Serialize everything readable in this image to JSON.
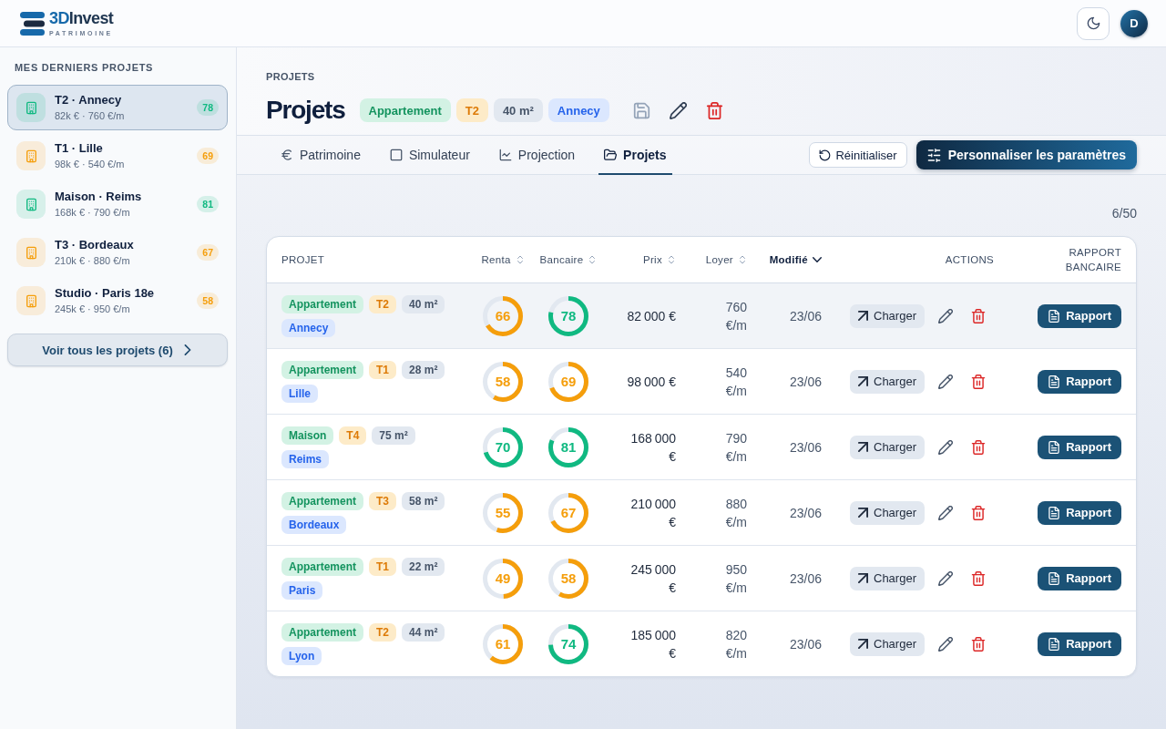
{
  "brand": {
    "name_lead": "3D",
    "name_rest": "Invest",
    "tagline": "PATRIMOINE"
  },
  "user": {
    "initial": "D"
  },
  "sidebar": {
    "title": "MES DERNIERS PROJETS",
    "items": [
      {
        "title": "T2 · Annecy",
        "subtitle": "82k € · 760 €/m",
        "score": "78",
        "color": "#10b981",
        "selected": true
      },
      {
        "title": "T1 · Lille",
        "subtitle": "98k € · 540 €/m",
        "score": "69",
        "color": "#f59e0b",
        "selected": false
      },
      {
        "title": "Maison · Reims",
        "subtitle": "168k € · 790 €/m",
        "score": "81",
        "color": "#10b981",
        "selected": false
      },
      {
        "title": "T3 · Bordeaux",
        "subtitle": "210k € · 880 €/m",
        "score": "67",
        "color": "#f59e0b",
        "selected": false
      },
      {
        "title": "Studio · Paris 18e",
        "subtitle": "245k € · 950 €/m",
        "score": "58",
        "color": "#f59e0b",
        "selected": false
      }
    ],
    "view_all": "Voir tous les projets (6)"
  },
  "page": {
    "breadcrumb": "PROJETS",
    "title": "Projets",
    "tags": [
      {
        "kind": "type",
        "label": "Appartement"
      },
      {
        "kind": "rooms",
        "label": "T2"
      },
      {
        "kind": "area",
        "label": "40 m²"
      },
      {
        "kind": "city",
        "label": "Annecy"
      }
    ],
    "actions": [
      {
        "kind": "save",
        "disabled": true
      },
      {
        "kind": "edit",
        "disabled": false
      },
      {
        "kind": "delete",
        "disabled": false
      }
    ]
  },
  "tabs": [
    {
      "kind": "euro",
      "label": "Patrimoine",
      "selected": false
    },
    {
      "kind": "square",
      "label": "Simulateur",
      "selected": false
    },
    {
      "kind": "chart",
      "label": "Projection",
      "selected": false
    },
    {
      "kind": "folder",
      "label": "Projets",
      "selected": true
    }
  ],
  "toolbar": {
    "reset": "Réinitialiser",
    "customize": "Personnaliser les paramètres"
  },
  "count": "6/50",
  "table": {
    "columns": [
      {
        "label": "PROJET",
        "sortable": false,
        "sorted": false
      },
      {
        "label": "Renta",
        "sortable": true,
        "sorted": false
      },
      {
        "label": "Bancaire",
        "sortable": true,
        "sorted": false
      },
      {
        "label": "Prix",
        "sortable": true,
        "sorted": false
      },
      {
        "label": "Loyer",
        "sortable": true,
        "sorted": false
      },
      {
        "label": "Modifié",
        "sortable": true,
        "sorted": true
      },
      {
        "label": "ACTIONS",
        "sortable": false,
        "sorted": false
      },
      {
        "label": "RAPPORT BANCAIRE",
        "sortable": false,
        "sorted": false
      }
    ],
    "rows": [
      {
        "selected": true,
        "tags": [
          {
            "kind": "type",
            "label": "Appartement"
          },
          {
            "kind": "rooms",
            "label": "T2"
          },
          {
            "kind": "area",
            "label": "40 m²"
          },
          {
            "kind": "city",
            "label": "Annecy"
          }
        ],
        "renta": {
          "value": "66",
          "level": 0.66
        },
        "bancaire": {
          "value": "78",
          "level": 0.78
        },
        "prix": "82 000 €",
        "loyer": "760 €/m",
        "modified": "23/06",
        "load": "Charger",
        "report": "Rapport"
      },
      {
        "selected": false,
        "tags": [
          {
            "kind": "type",
            "label": "Appartement"
          },
          {
            "kind": "rooms",
            "label": "T1"
          },
          {
            "kind": "area",
            "label": "28 m²"
          },
          {
            "kind": "city",
            "label": "Lille"
          }
        ],
        "renta": {
          "value": "58",
          "level": 0.58
        },
        "bancaire": {
          "value": "69",
          "level": 0.69
        },
        "prix": "98 000 €",
        "loyer": "540 €/m",
        "modified": "23/06",
        "load": "Charger",
        "report": "Rapport"
      },
      {
        "selected": false,
        "tags": [
          {
            "kind": "type",
            "label": "Maison"
          },
          {
            "kind": "rooms",
            "label": "T4"
          },
          {
            "kind": "area",
            "label": "75 m²"
          },
          {
            "kind": "city",
            "label": "Reims"
          }
        ],
        "renta": {
          "value": "70",
          "level": 0.7
        },
        "bancaire": {
          "value": "81",
          "level": 0.81
        },
        "prix": "168 000 €",
        "loyer": "790 €/m",
        "modified": "23/06",
        "load": "Charger",
        "report": "Rapport"
      },
      {
        "selected": false,
        "tags": [
          {
            "kind": "type",
            "label": "Appartement"
          },
          {
            "kind": "rooms",
            "label": "T3"
          },
          {
            "kind": "area",
            "label": "58 m²"
          },
          {
            "kind": "city",
            "label": "Bordeaux"
          }
        ],
        "renta": {
          "value": "55",
          "level": 0.55
        },
        "bancaire": {
          "value": "67",
          "level": 0.67
        },
        "prix": "210 000 €",
        "loyer": "880 €/m",
        "modified": "23/06",
        "load": "Charger",
        "report": "Rapport"
      },
      {
        "selected": false,
        "tags": [
          {
            "kind": "type",
            "label": "Appartement"
          },
          {
            "kind": "rooms",
            "label": "T1"
          },
          {
            "kind": "area",
            "label": "22 m²"
          },
          {
            "kind": "city",
            "label": "Paris"
          }
        ],
        "renta": {
          "value": "49",
          "level": 0.49
        },
        "bancaire": {
          "value": "58",
          "level": 0.58
        },
        "prix": "245 000 €",
        "loyer": "950 €/m",
        "modified": "23/06",
        "load": "Charger",
        "report": "Rapport"
      },
      {
        "selected": false,
        "tags": [
          {
            "kind": "type",
            "label": "Appartement"
          },
          {
            "kind": "rooms",
            "label": "T2"
          },
          {
            "kind": "area",
            "label": "44 m²"
          },
          {
            "kind": "city",
            "label": "Lyon"
          }
        ],
        "renta": {
          "value": "61",
          "level": 0.61
        },
        "bancaire": {
          "value": "74",
          "level": 0.74
        },
        "prix": "185 000 €",
        "loyer": "820 €/m",
        "modified": "23/06",
        "load": "Charger",
        "report": "Rapport"
      }
    ]
  }
}
